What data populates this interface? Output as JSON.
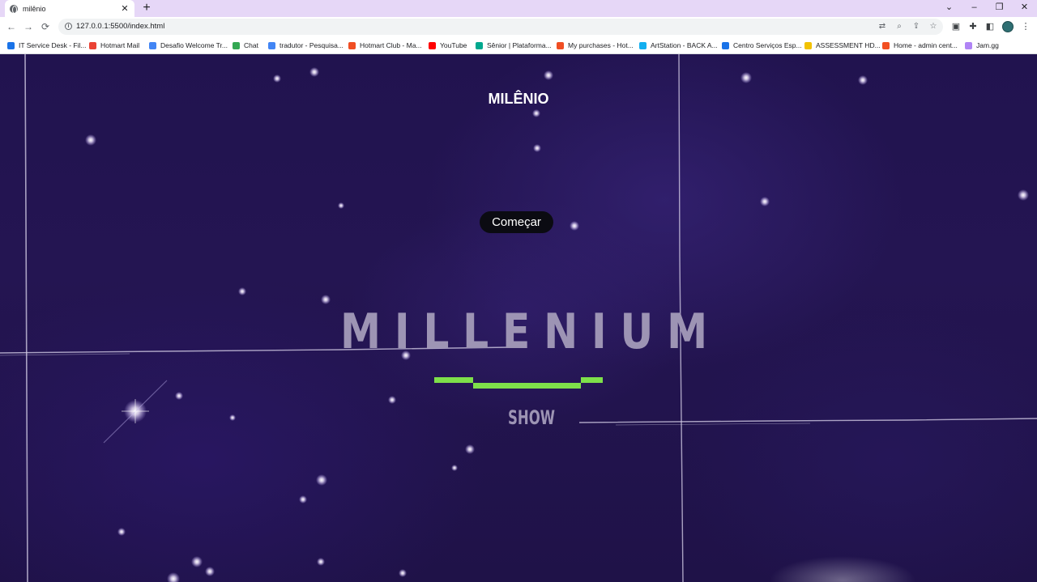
{
  "browser": {
    "tab_title": "milênio",
    "tab_close": "✕",
    "new_tab": "+",
    "window_controls": [
      "⌄",
      "–",
      "❐",
      "✕"
    ],
    "url": "127.0.0.1:5500/index.html",
    "bookmarks": [
      {
        "label": "IT Service Desk - Fil...",
        "color": "#1a73e8"
      },
      {
        "label": "Hotmart Mail",
        "color": "#ea4335"
      },
      {
        "label": "Desafio Welcome Tr...",
        "color": "#4285f4"
      },
      {
        "label": "Chat",
        "color": "#34a853"
      },
      {
        "label": "tradutor - Pesquisa...",
        "color": "#4285f4"
      },
      {
        "label": "Hotmart Club - Ma...",
        "color": "#f04e23"
      },
      {
        "label": "YouTube",
        "color": "#ff0000"
      },
      {
        "label": "Sênior | Plataforma...",
        "color": "#00a88e"
      },
      {
        "label": "My purchases - Hot...",
        "color": "#f04e23"
      },
      {
        "label": "ArtStation - BACK A...",
        "color": "#13aff0"
      },
      {
        "label": "Centro Serviços Esp...",
        "color": "#1a73e8"
      },
      {
        "label": "ASSESSMENT HD...",
        "color": "#f2c200"
      },
      {
        "label": "Home - admin cent...",
        "color": "#f25022"
      },
      {
        "label": "Jam.gg",
        "color": "#b084f5"
      }
    ]
  },
  "page": {
    "title": "MILÊNIO",
    "start_button": "Começar",
    "logo_word": "MILLENIUM",
    "logo_sub": "SHOW",
    "logo_text_color": "#9d94b4",
    "logo_bar_color": "#7ee04a",
    "background_color": "#21134f"
  }
}
